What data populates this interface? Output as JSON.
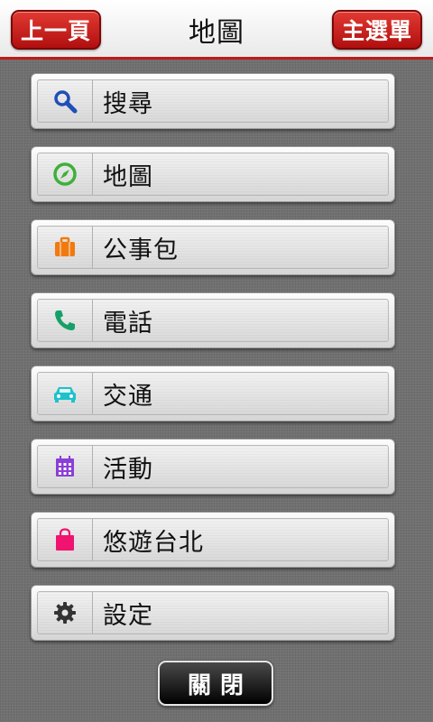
{
  "header": {
    "back_label": "上一頁",
    "title": "地圖",
    "menu_label": "主選單"
  },
  "menu": {
    "items": [
      {
        "label": "搜尋",
        "icon": "search-icon",
        "color": "#1f4fb8"
      },
      {
        "label": "地圖",
        "icon": "compass-icon",
        "color": "#3db03a"
      },
      {
        "label": "公事包",
        "icon": "briefcase-icon",
        "color": "#f07a10"
      },
      {
        "label": "電話",
        "icon": "phone-icon",
        "color": "#15a06a"
      },
      {
        "label": "交通",
        "icon": "car-icon",
        "color": "#1ec1cc"
      },
      {
        "label": "活動",
        "icon": "calendar-icon",
        "color": "#8a3fd6"
      },
      {
        "label": "悠遊台北",
        "icon": "shopping-bag-icon",
        "color": "#f0136f"
      },
      {
        "label": "設定",
        "icon": "gear-icon",
        "color": "#333333"
      }
    ]
  },
  "footer": {
    "close_label": "關閉"
  },
  "colors": {
    "header_accent": "#c01a1a",
    "header_button": "#c8181a",
    "background": "#6f706f"
  }
}
